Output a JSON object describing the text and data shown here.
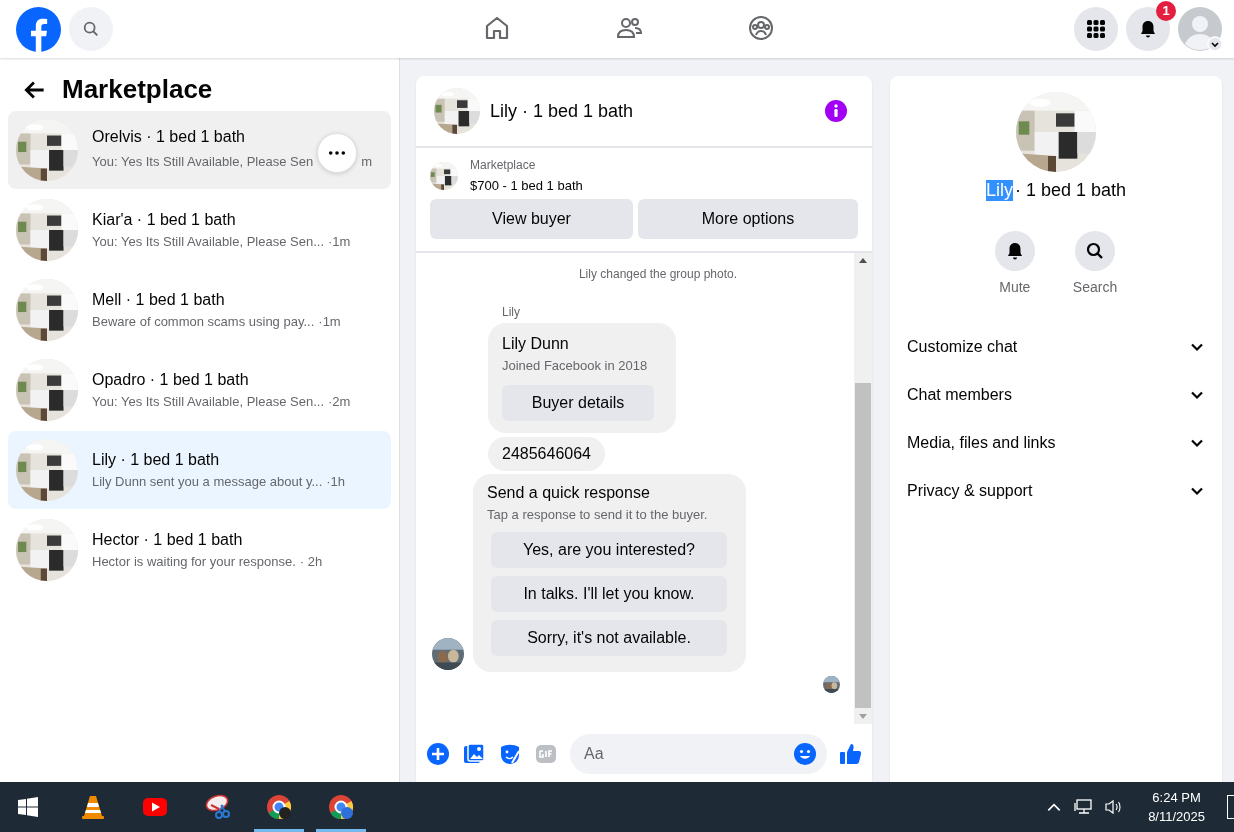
{
  "top_bar": {
    "nav": [
      {
        "kind": "home",
        "selected": false
      },
      {
        "kind": "friends",
        "selected": false
      },
      {
        "kind": "groups",
        "selected": false
      }
    ],
    "notification_count": "1"
  },
  "sidebar": {
    "title": "Marketplace",
    "conversations": [
      {
        "name": "Orelvis · 1 bed 1 bath",
        "preview": "You: Yes Its Still Available, Please Sen",
        "time": "m",
        "selected": false,
        "hovered": true
      },
      {
        "name": "Kiar'a · 1 bed 1 bath",
        "preview": "You: Yes Its Still Available, Please Sen...",
        "time": "·1m",
        "selected": false,
        "hovered": false
      },
      {
        "name": "Mell · 1 bed 1 bath",
        "preview": "Beware of common scams using pay...",
        "time": "·1m",
        "selected": false,
        "hovered": false
      },
      {
        "name": "Opadro · 1 bed 1 bath",
        "preview": "You: Yes Its Still Available, Please Sen...",
        "time": "·2m",
        "selected": false,
        "hovered": false
      },
      {
        "name": "Lily · 1 bed 1 bath",
        "preview": "Lily Dunn sent you a message about y...",
        "time": "·1h",
        "selected": true,
        "hovered": false
      },
      {
        "name": "Hector · 1 bed 1 bath",
        "preview": "Hector is waiting for your response.",
        "time": "· 2h",
        "selected": false,
        "hovered": false
      }
    ]
  },
  "chat": {
    "title": "Lily · 1 bed 1 bath",
    "listing": {
      "source": "Marketplace",
      "summary": "$700 - 1 bed 1 bath"
    },
    "buttons": [
      "View buyer",
      "More options"
    ],
    "system_message": "Lily changed the group photo.",
    "sender": "Lily",
    "buyer_card": {
      "name": "Lily Dunn",
      "joined": "Joined Facebook in 2018",
      "button": "Buyer details"
    },
    "phone_message": "2485646064",
    "quick_response": {
      "title": "Send a quick response",
      "subtitle": "Tap a response to send it to the buyer.",
      "options": [
        "Yes, are you interested?",
        "In talks. I'll let you know.",
        "Sorry, it's not available."
      ]
    },
    "composer": {
      "placeholder": "Aa"
    }
  },
  "details": {
    "name_selected": "Lily",
    "name_rest": "· 1 bed 1 bath",
    "actions": [
      {
        "kind": "bell",
        "label": "Mute"
      },
      {
        "kind": "search",
        "label": "Search"
      }
    ],
    "sections": [
      {
        "label": "Customize chat",
        "expanded": false
      },
      {
        "label": "Chat members",
        "expanded": false
      },
      {
        "label": "Media, files and links",
        "expanded": false
      },
      {
        "label": "Privacy & support",
        "expanded": false
      }
    ]
  },
  "taskbar": {
    "apps": [
      {
        "kind": "cone",
        "running": false
      },
      {
        "kind": "video",
        "running": false
      },
      {
        "kind": "snip",
        "running": false
      },
      {
        "kind": "browser",
        "running": true
      },
      {
        "kind": "browser-profile",
        "running": true
      }
    ],
    "time": "6:24 PM",
    "date": "8/11/2025"
  }
}
